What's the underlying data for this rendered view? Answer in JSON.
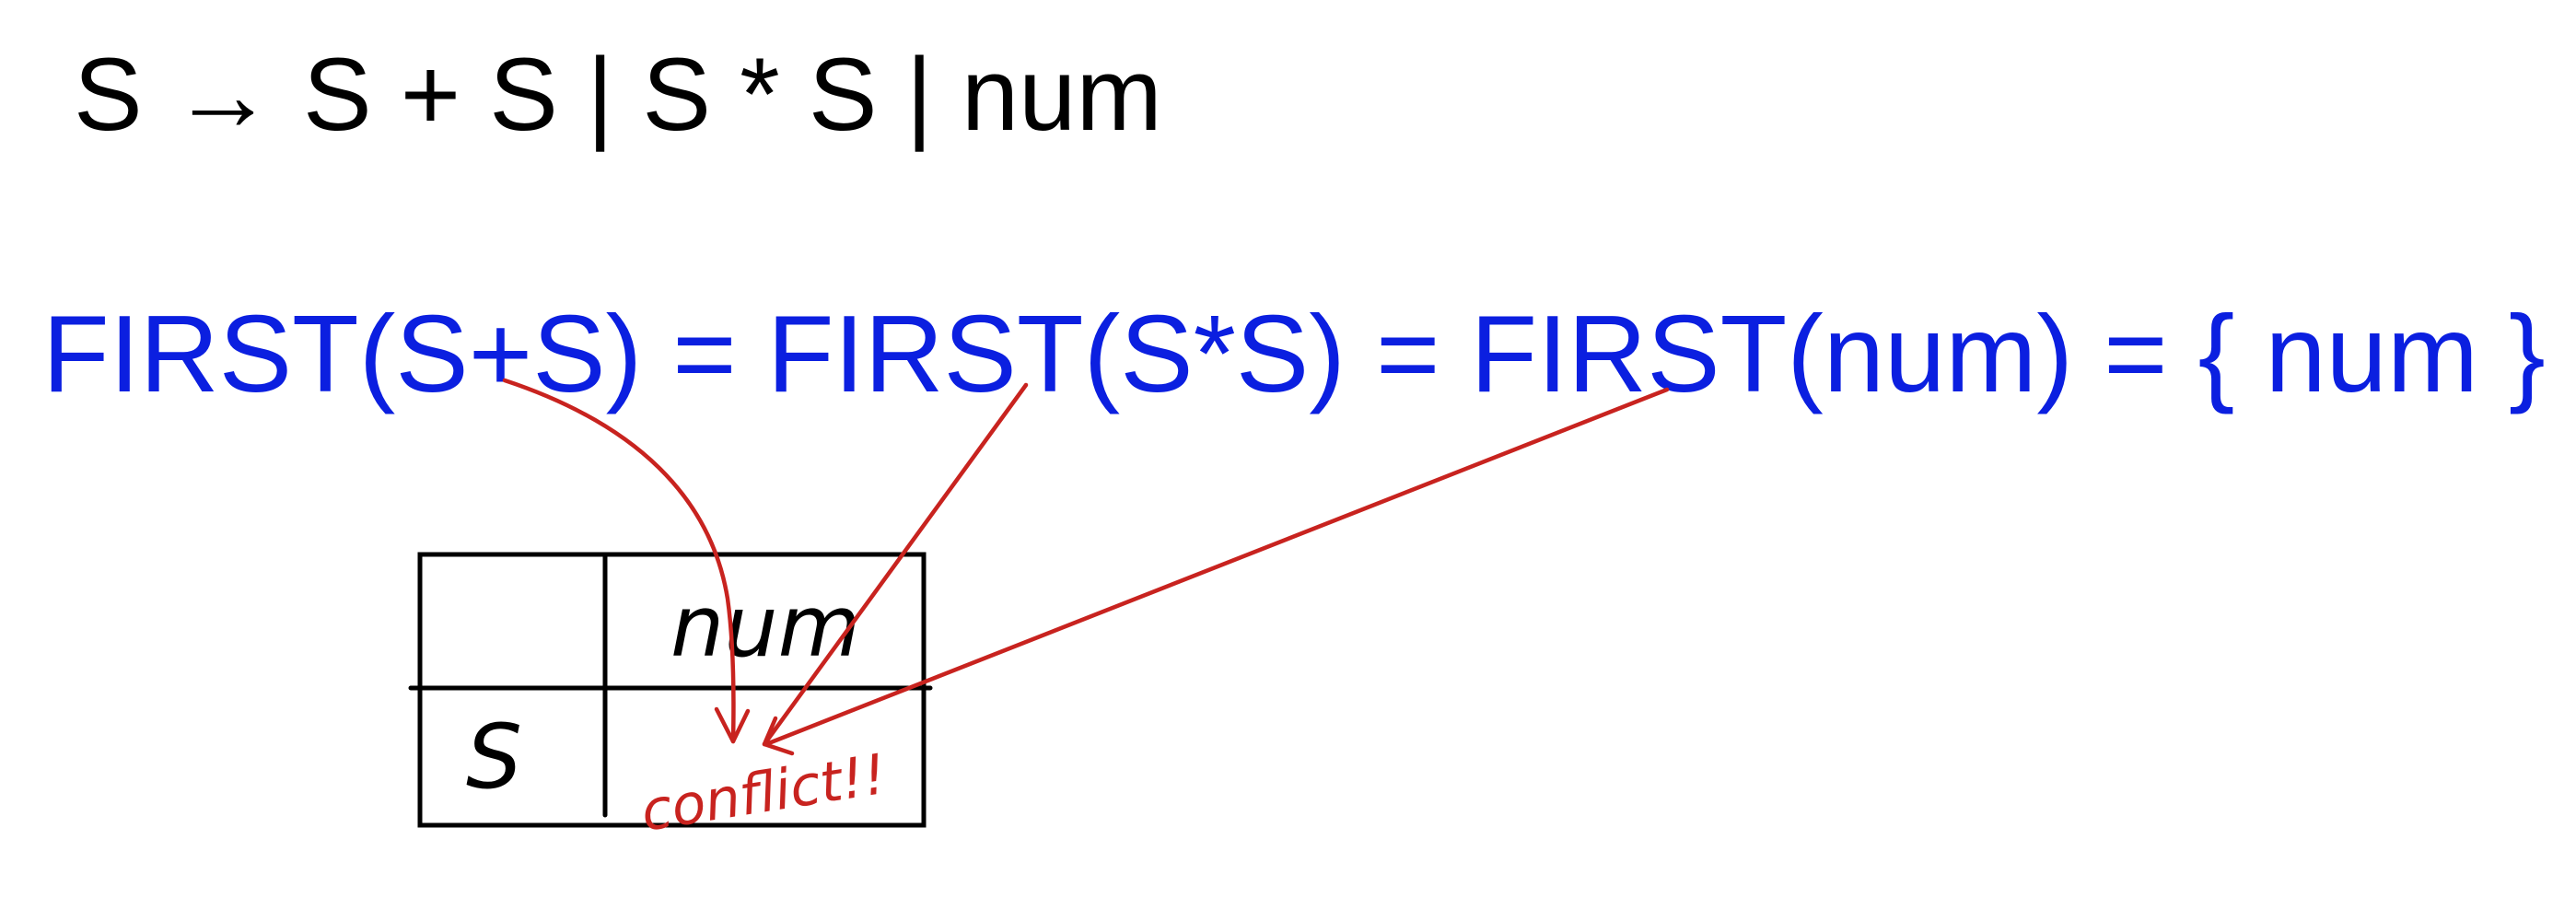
{
  "grammar": {
    "lhs": "S",
    "arrow": "→",
    "rhs": "S + S | S * S | num"
  },
  "first_sets": {
    "text": "FIRST(S+S) = FIRST(S*S) = FIRST(num) = { num }"
  },
  "parse_table": {
    "column_header": "num",
    "row_header": "S",
    "cell_note": "conflict!!"
  },
  "colors": {
    "grammar_text": "#000000",
    "first_text": "#0b1fe0",
    "annotation": "#c8231f"
  }
}
